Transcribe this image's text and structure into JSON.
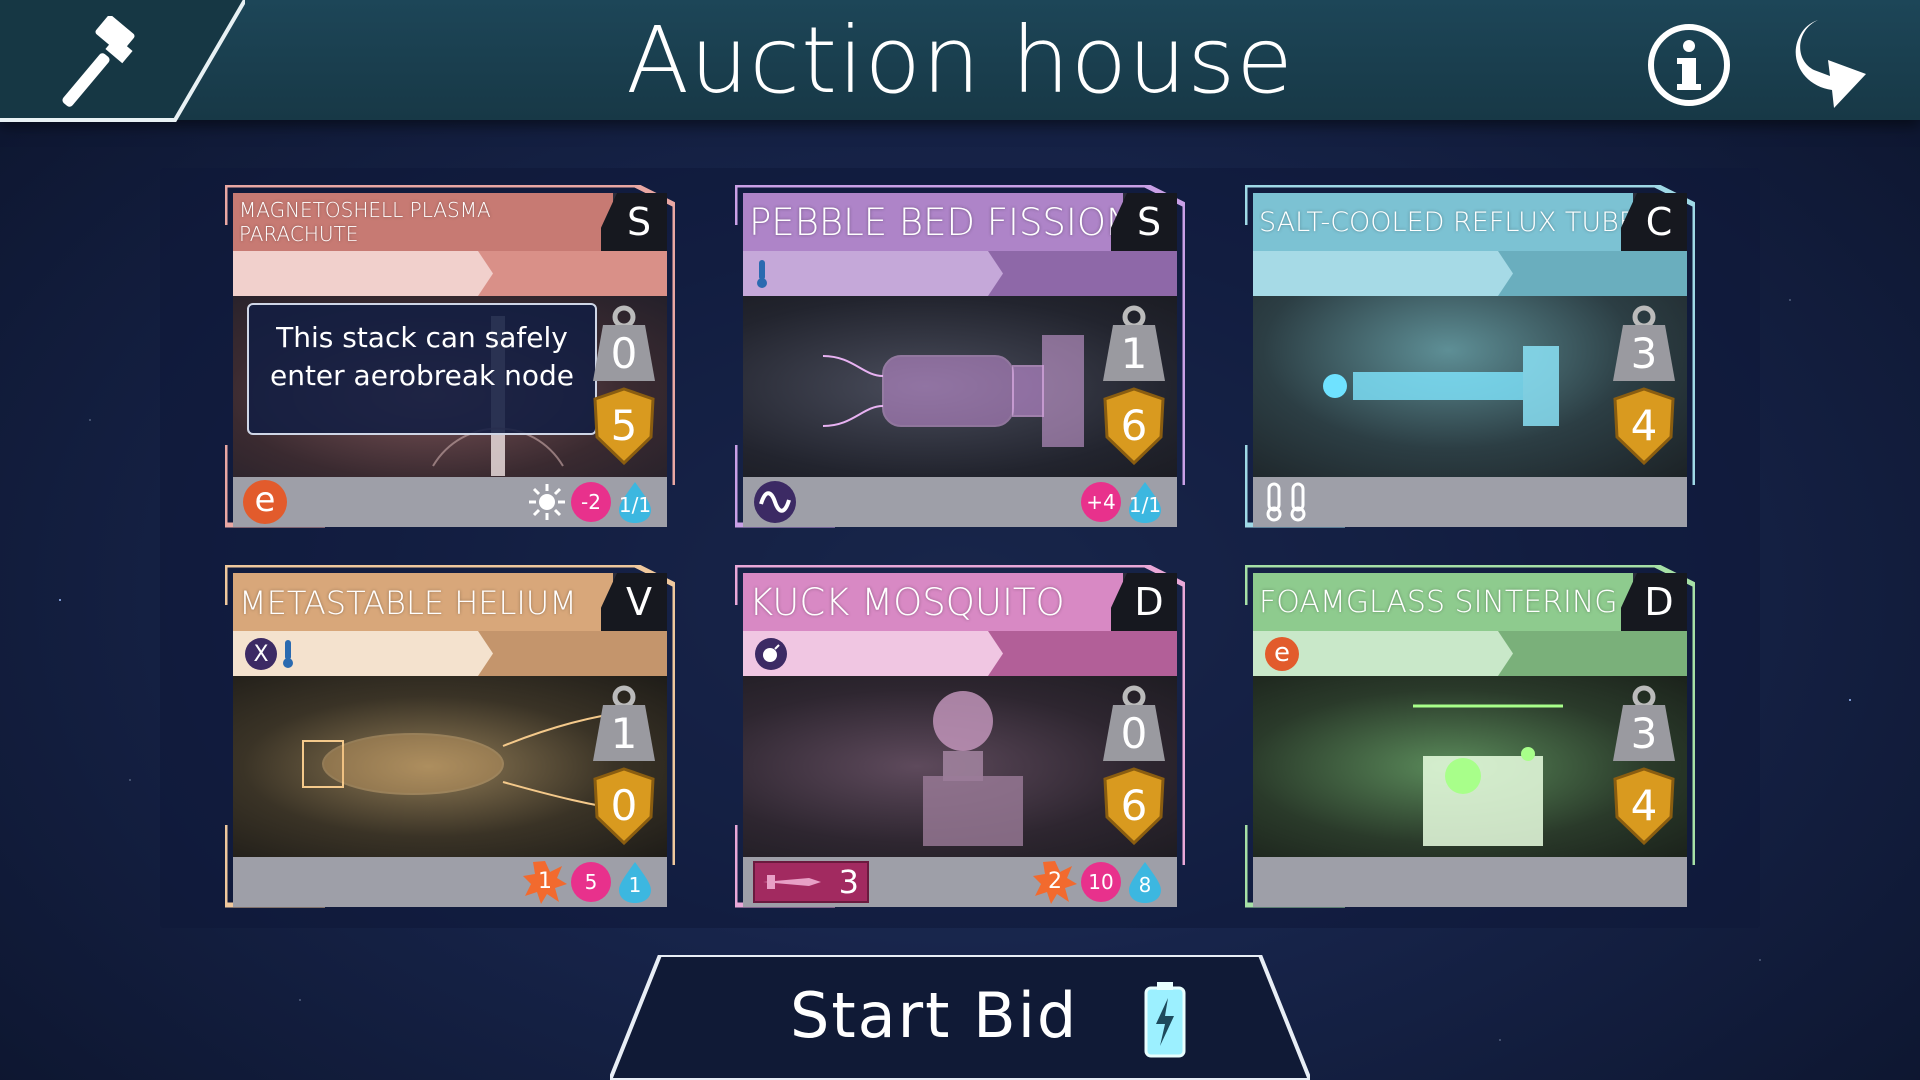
{
  "header": {
    "title": "Auction house",
    "hammer_icon": "auction-hammer-icon",
    "info_icon": "info-icon",
    "back_icon": "back-arrow-icon"
  },
  "cards": [
    {
      "name": "MAGNETOSHELL PLASMA PARACHUTE",
      "grade": "S",
      "weight": "0",
      "armor": "5",
      "tooltip": "This stack can safely enter aerobreak node",
      "tag_icons": [],
      "footer_left_icon": "e",
      "footer_right": {
        "sun_icon": "sun-icon",
        "pink": "-2",
        "drop": "1/1"
      },
      "accent": "#d47a76"
    },
    {
      "name": "PEBBLE BED FISSION",
      "grade": "S",
      "weight": "1",
      "armor": "6",
      "tag_icons": [
        "thermometer-icon"
      ],
      "footer_left_icon": "wave-icon",
      "footer_right": {
        "pink": "+4",
        "drop": "1/1"
      },
      "accent": "#b78bd1"
    },
    {
      "name": "SALT-COOLED REFLUX TUBE",
      "grade": "C",
      "weight": "3",
      "armor": "4",
      "tag_icons": [],
      "footer_left_icon": "double-thermometer-icon",
      "accent": "#7fc6d7"
    },
    {
      "name": "METASTABLE HELIUM",
      "grade": "V",
      "weight": "1",
      "armor": "0",
      "tag_icons": [
        "x-icon",
        "thermometer-icon"
      ],
      "footer_right": {
        "burst": "1",
        "pink": "5",
        "drop": "1"
      },
      "accent": "#e6b884"
    },
    {
      "name": "KUCK MOSQUITO",
      "grade": "D",
      "weight": "0",
      "armor": "6",
      "tag_icons": [
        "bomb-icon"
      ],
      "weapon": {
        "icon": "missile-icon",
        "count": "3"
      },
      "footer_right": {
        "burst": "2",
        "pink": "10",
        "drop": "8"
      },
      "accent": "#de8fcb"
    },
    {
      "name": "FOAMGLASS SINTERING",
      "grade": "D",
      "weight": "3",
      "armor": "4",
      "tag_icons": [
        "e-icon"
      ],
      "accent": "#8fcf8f"
    }
  ],
  "start_bid": {
    "label": "Start Bid",
    "icon": "battery-charge-icon"
  }
}
